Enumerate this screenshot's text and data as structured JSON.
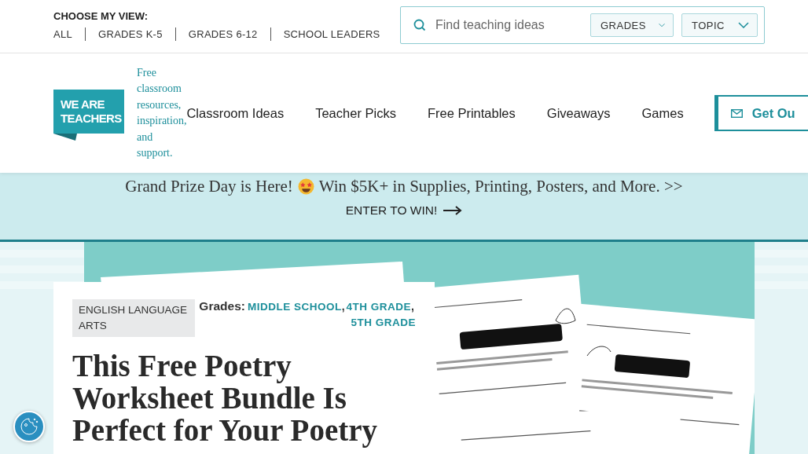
{
  "view_switcher": {
    "label": "CHOOSE MY VIEW:",
    "options": [
      {
        "label": "ALL"
      },
      {
        "label": "GRADES K-5"
      },
      {
        "label": "GRADES 6-12"
      },
      {
        "label": "SCHOOL LEADERS"
      }
    ]
  },
  "search": {
    "placeholder": "Find teaching ideas",
    "filters": [
      "GRADES",
      "TOPIC"
    ]
  },
  "logo": {
    "lines": [
      "WE ARE",
      "TEACHERS"
    ],
    "tagline": "Free classroom resources, inspiration, and support."
  },
  "nav": [
    "Classroom Ideas",
    "Teacher Picks",
    "Free Printables",
    "Giveaways",
    "Games"
  ],
  "cta": {
    "label": "Get Ou"
  },
  "banner": {
    "headline_start": "Grand Prize Day is Here!",
    "headline_end": "Win $5K+ in Supplies, Printing, Posters, and More. >>",
    "link": "ENTER TO WIN!"
  },
  "article": {
    "category": "ENGLISH LANGUAGE ARTS",
    "grades_label": "Grades:",
    "grades": [
      {
        "label": "MIDDLE SCHOOL",
        "separator": ","
      },
      {
        "label": "4TH GRADE",
        "separator": ","
      },
      {
        "label": "5TH GRADE"
      }
    ],
    "title": "This Free Poetry Worksheet Bundle Is Perfect for Your Poetry"
  }
}
